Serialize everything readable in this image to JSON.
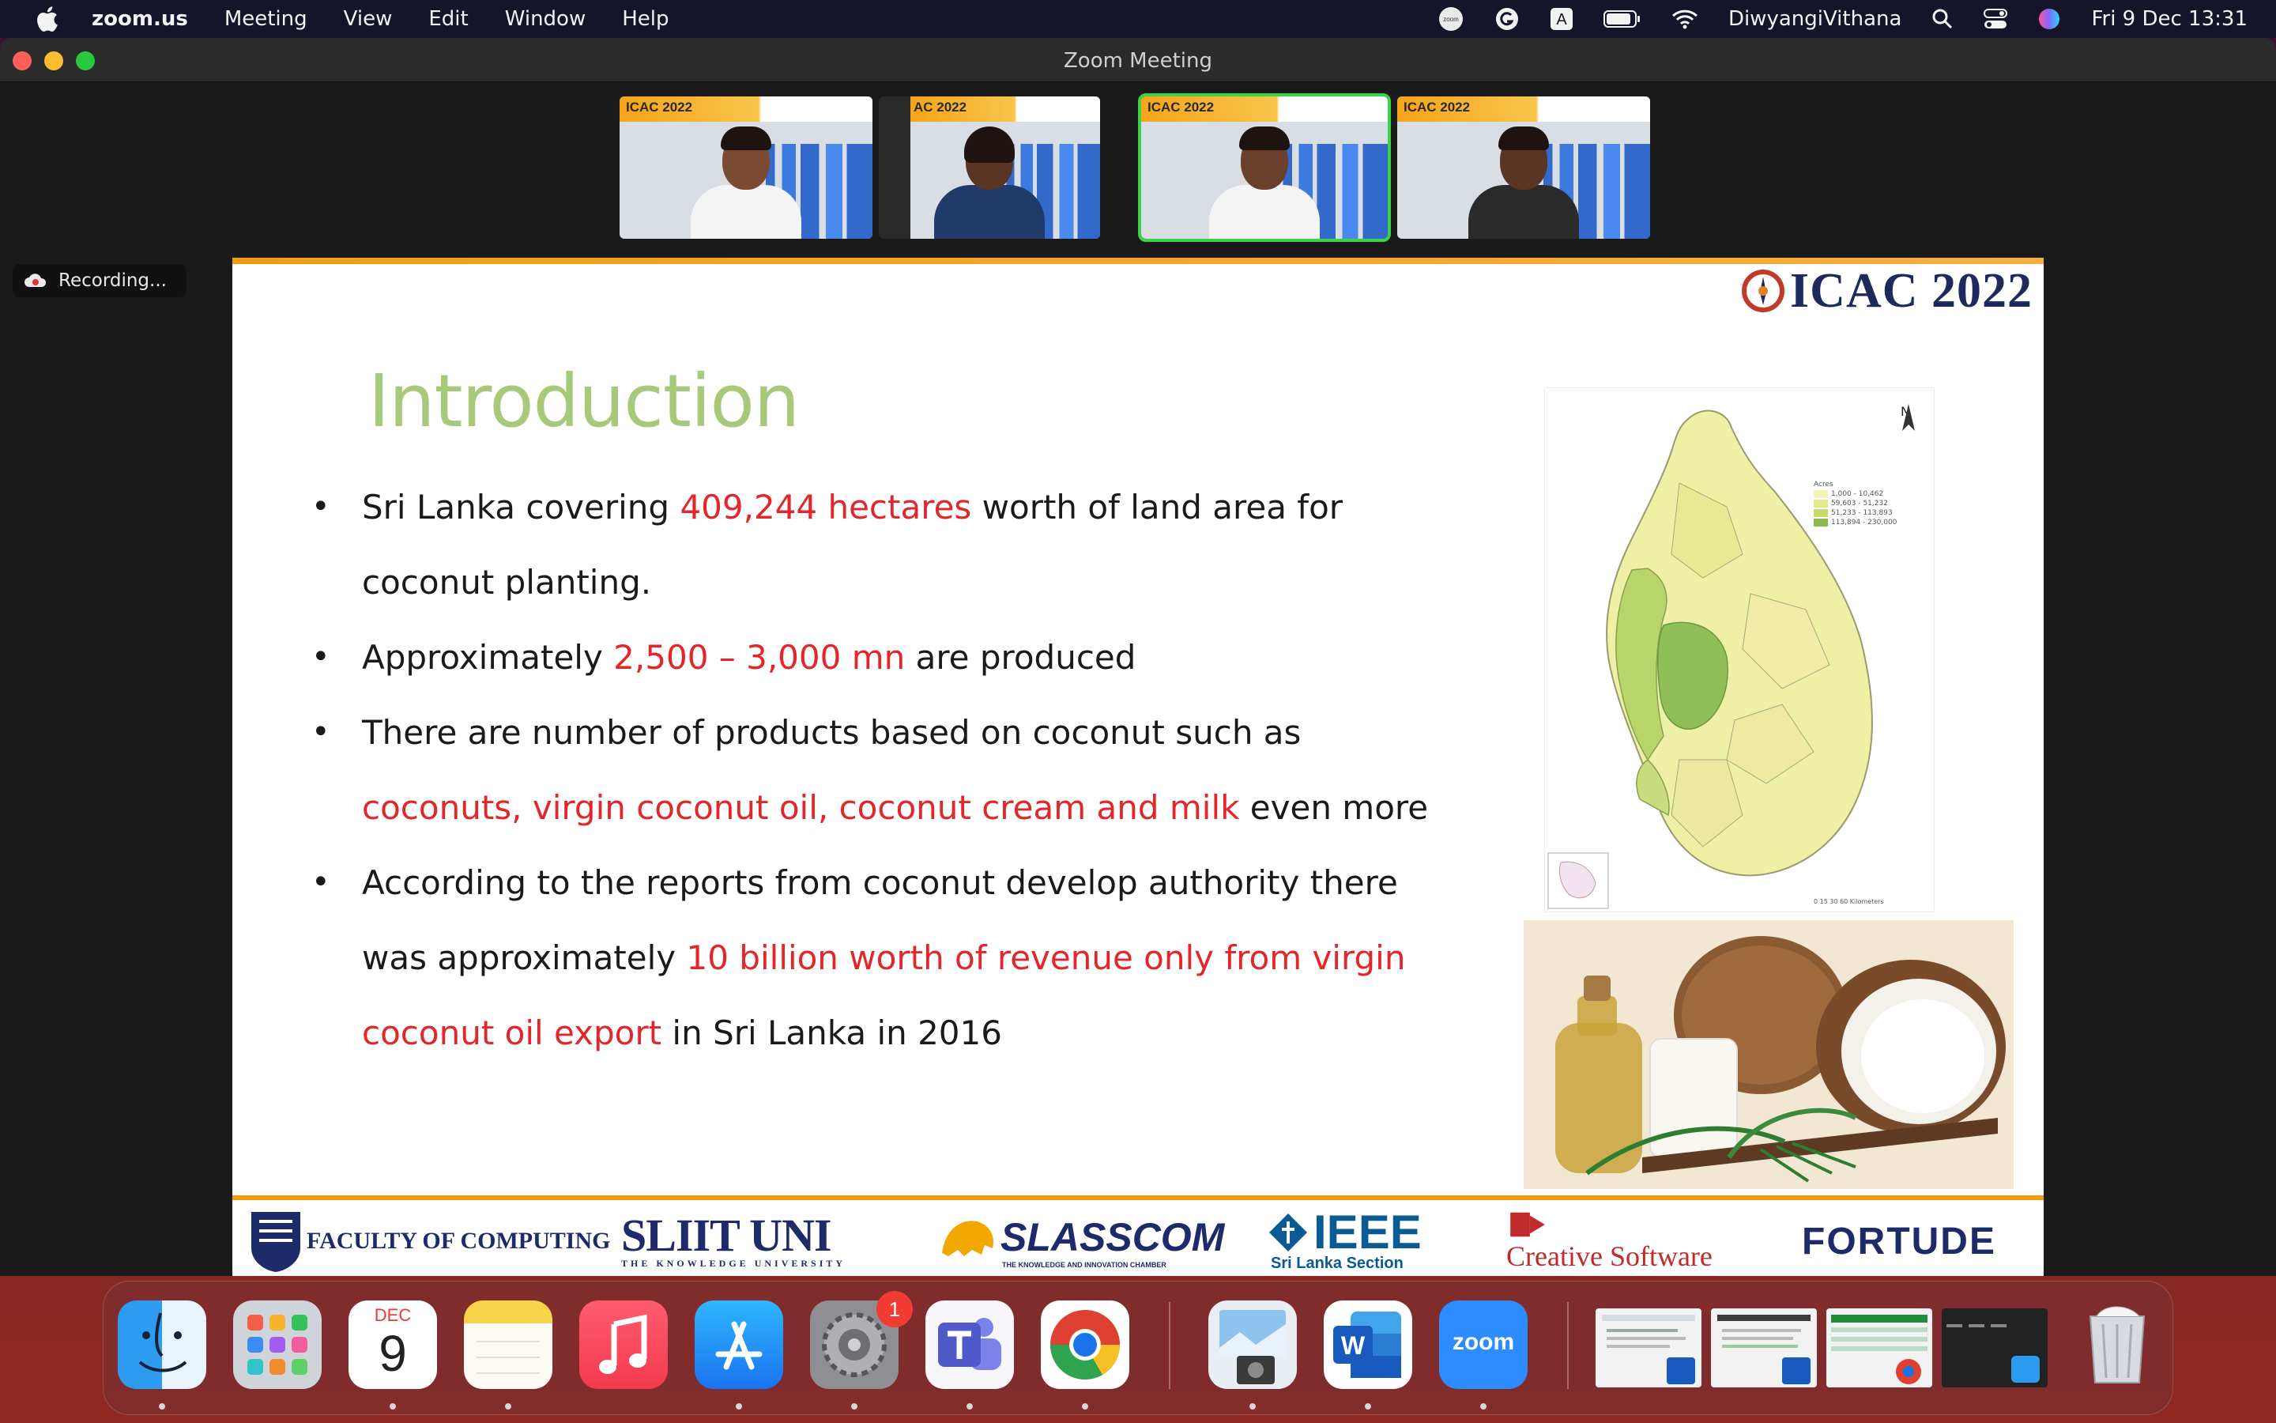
{
  "menubar": {
    "app_name": "zoom.us",
    "menus": [
      "Meeting",
      "View",
      "Edit",
      "Window",
      "Help"
    ],
    "user": "DiwyangiVithana",
    "clock": "Fri 9 Dec  13:31",
    "status_icons": [
      "zoom-status-icon",
      "grammarly-icon",
      "input-source-icon",
      "battery-icon",
      "wifi-icon",
      "spotlight-search-icon",
      "control-center-icon",
      "siri-icon"
    ],
    "input_source": "A",
    "zoom_icon_text": "zoom"
  },
  "window": {
    "title": "Zoom Meeting"
  },
  "thumbnails": [
    {
      "banner": "ICAC 2022",
      "active": false
    },
    {
      "banner": "AC 2022",
      "active": false
    },
    {
      "banner": "ICAC 2022",
      "active": true
    },
    {
      "banner": "ICAC 2022",
      "active": false
    }
  ],
  "recording": {
    "label": "Recording..."
  },
  "slide": {
    "logo_text": "ICAC 2022",
    "title": "Introduction",
    "bullets": [
      {
        "parts": [
          {
            "text": "Sri Lanka  covering ",
            "hl": false
          },
          {
            "text": "409,244 hectares",
            "hl": true
          },
          {
            "text": " worth of land area for coconut planting.",
            "hl": false
          }
        ]
      },
      {
        "parts": [
          {
            "text": "Approximately ",
            "hl": false
          },
          {
            "text": "2,500 – 3,000 mn",
            "hl": true
          },
          {
            "text": " are produced",
            "hl": false
          }
        ]
      },
      {
        "parts": [
          {
            "text": "There are number of products based on coconut such as ",
            "hl": false
          },
          {
            "text": "coconuts, virgin coconut oil, coconut cream and milk",
            "hl": true
          },
          {
            "text": " even more",
            "hl": false
          }
        ]
      },
      {
        "parts": [
          {
            "text": "According to the reports from coconut develop authority there was approximately ",
            "hl": false
          },
          {
            "text": "10 billion worth of revenue only from virgin coconut oil export",
            "hl": true
          },
          {
            "text": " in Sri Lanka in 2016",
            "hl": false
          }
        ]
      }
    ],
    "map": {
      "north": "N",
      "legend_title": "Acres",
      "legend": [
        "1,000 - 10,462",
        "59,603 - 51,232",
        "51,233 - 113,893",
        "113,894 - 230,000"
      ],
      "legend_colors": [
        "#f6f2b8",
        "#e4ea8c",
        "#c4dc6a",
        "#88bb50"
      ],
      "scale": "0    15   30         60 Kilometers"
    },
    "sponsors": {
      "faculty": "FACULTY OF COMPUTING",
      "sliit": "SLIIT UNI",
      "sliit_tagline": "THE KNOWLEDGE UNIVERSITY",
      "slasscom": "SLASSCOM",
      "slasscom_tagline": "THE KNOWLEDGE AND INNOVATION CHAMBER",
      "ieee": "IEEE",
      "ieee_sub": "Sri Lanka Section",
      "creative": "Creative Software",
      "fortude": "FORTUDE"
    }
  },
  "dock": {
    "calendar_month": "DEC",
    "calendar_day": "9",
    "settings_badge": "1",
    "zoom_label": "zoom",
    "word_label": "W",
    "apps": [
      "finder",
      "launchpad",
      "calendar",
      "notes",
      "music",
      "app-store",
      "system-settings",
      "teams",
      "chrome",
      "preview",
      "word",
      "zoom"
    ]
  }
}
